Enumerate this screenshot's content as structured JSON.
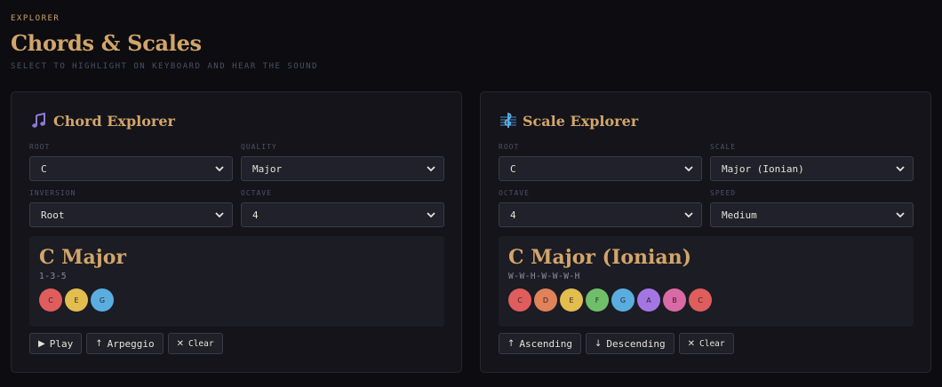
{
  "header": {
    "eyebrow": "EXPLORER",
    "title": "Chords & Scales",
    "subtitle": "SELECT TO HIGHLIGHT ON KEYBOARD AND HEAR THE SOUND"
  },
  "chord": {
    "title": "Chord Explorer",
    "icon": "music-note-icon",
    "fields": {
      "root": {
        "label": "ROOT",
        "value": "C"
      },
      "quality": {
        "label": "QUALITY",
        "value": "Major"
      },
      "inversion": {
        "label": "INVERSION",
        "value": "Root"
      },
      "octave": {
        "label": "OCTAVE",
        "value": "4"
      }
    },
    "name": "C Major",
    "formula": "1-3-5",
    "notes": [
      {
        "label": "C",
        "color": "#e05d5d"
      },
      {
        "label": "E",
        "color": "#e2be4f"
      },
      {
        "label": "G",
        "color": "#5aaedf"
      }
    ],
    "buttons": {
      "play": {
        "icon": "▶",
        "label": "Play"
      },
      "arpeggio": {
        "icon": "↑",
        "label": "Arpeggio"
      },
      "clear": {
        "icon": "✕",
        "label": "Clear"
      }
    }
  },
  "scale": {
    "title": "Scale Explorer",
    "icon": "treble-clef-icon",
    "fields": {
      "root": {
        "label": "ROOT",
        "value": "C"
      },
      "scale": {
        "label": "SCALE",
        "value": "Major (Ionian)"
      },
      "octave": {
        "label": "OCTAVE",
        "value": "4"
      },
      "speed": {
        "label": "SPEED",
        "value": "Medium"
      }
    },
    "name": "C Major (Ionian)",
    "formula": "W-W-H-W-W-W-H",
    "notes": [
      {
        "label": "C",
        "color": "#e05d5d"
      },
      {
        "label": "D",
        "color": "#e0825a"
      },
      {
        "label": "E",
        "color": "#e2be4f"
      },
      {
        "label": "F",
        "color": "#6fbf6a"
      },
      {
        "label": "G",
        "color": "#5aaedf"
      },
      {
        "label": "A",
        "color": "#a476e4"
      },
      {
        "label": "B",
        "color": "#d96aa6"
      },
      {
        "label": "C",
        "color": "#e05d5d"
      }
    ],
    "buttons": {
      "ascending": {
        "icon": "↑",
        "label": "Ascending"
      },
      "descending": {
        "icon": "↓",
        "label": "Descending"
      },
      "clear": {
        "icon": "✕",
        "label": "Clear"
      }
    }
  }
}
